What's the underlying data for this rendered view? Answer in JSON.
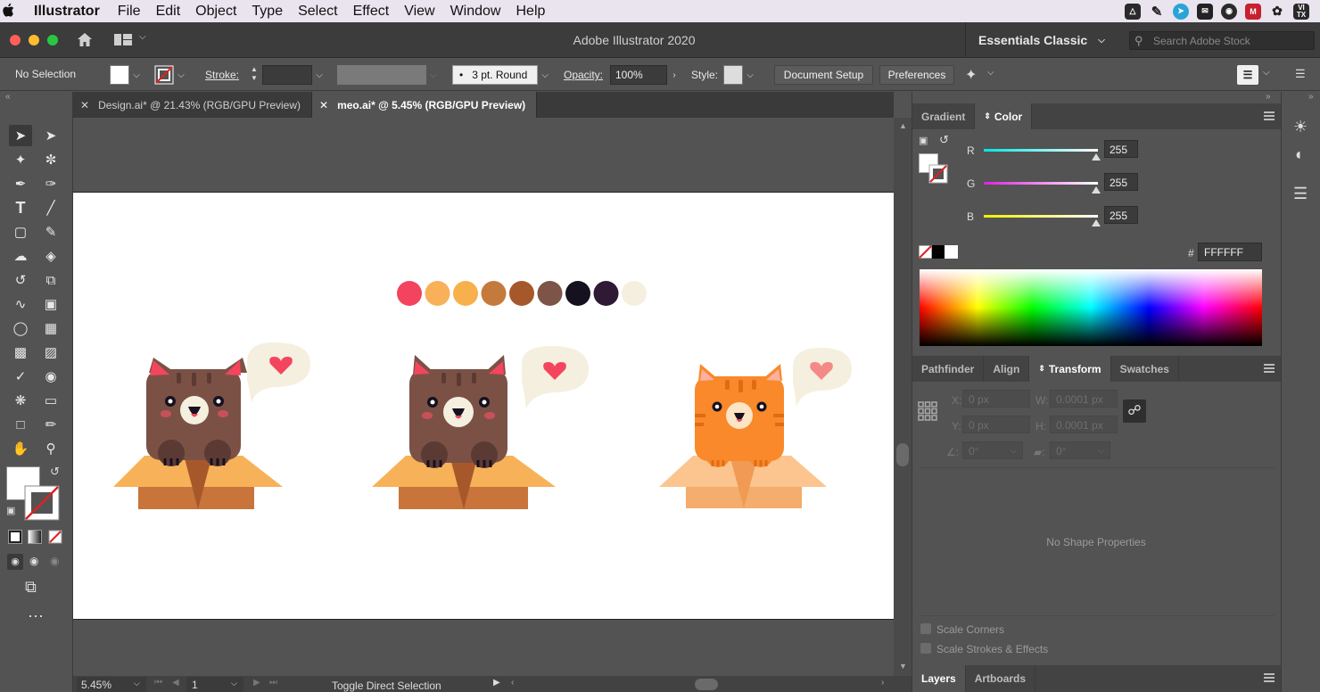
{
  "menubar": {
    "app": "Illustrator",
    "items": [
      "File",
      "Edit",
      "Object",
      "Type",
      "Select",
      "Effect",
      "View",
      "Window",
      "Help"
    ],
    "tray_icon": "VI TX"
  },
  "window": {
    "title": "Adobe Illustrator 2020",
    "workspace": "Essentials Classic",
    "search_placeholder": "Search Adobe Stock"
  },
  "control": {
    "selection": "No Selection",
    "stroke_label": "Stroke:",
    "brush": "3 pt. Round",
    "opacity_label": "Opacity:",
    "opacity": "100%",
    "style_label": "Style:",
    "document_setup": "Document Setup",
    "preferences": "Preferences"
  },
  "tabs": [
    {
      "label": "Design.ai* @ 21.43% (RGB/GPU Preview)",
      "active": false
    },
    {
      "label": "meo.ai* @ 5.45% (RGB/GPU Preview)",
      "active": true
    }
  ],
  "status": {
    "zoom": "5.45%",
    "artboard": "1",
    "tool_hint": "Toggle Direct Selection"
  },
  "color_panel": {
    "tabs": [
      "Gradient",
      "Color"
    ],
    "active_tab": "Color",
    "r_label": "R",
    "g_label": "G",
    "b_label": "B",
    "r": "255",
    "g": "255",
    "b": "255",
    "hash": "#",
    "hex": "FFFFFF"
  },
  "transform_panel": {
    "tabs": [
      "Pathfinder",
      "Align",
      "Transform",
      "Swatches"
    ],
    "active_tab": "Transform",
    "x_label": "X:",
    "y_label": "Y:",
    "w_label": "W:",
    "h_label": "H:",
    "x": "0 px",
    "y": "0 px",
    "w": "0.0001 px",
    "h": "0.0001 px",
    "angle": "0°",
    "shear": "0°",
    "empty": "No Shape Properties",
    "scale_corners": "Scale Corners",
    "scale_strokes": "Scale Strokes & Effects"
  },
  "layers_panel": {
    "tabs": [
      "Layers",
      "Artboards"
    ],
    "active_tab": "Layers"
  },
  "palette": [
    "#f3435f",
    "#f8b159",
    "#f8b04d",
    "#c57a3d",
    "#a7582a",
    "#7c5448",
    "#15111f",
    "#301934",
    "#f5efdf"
  ],
  "colors": {
    "cat_brown": "#7b5146",
    "cat_orange": "#f9892a",
    "box": "#f7b259",
    "box_dark": "#c8743a",
    "heart": "#f4455f",
    "bubble": "#f5efdf"
  }
}
